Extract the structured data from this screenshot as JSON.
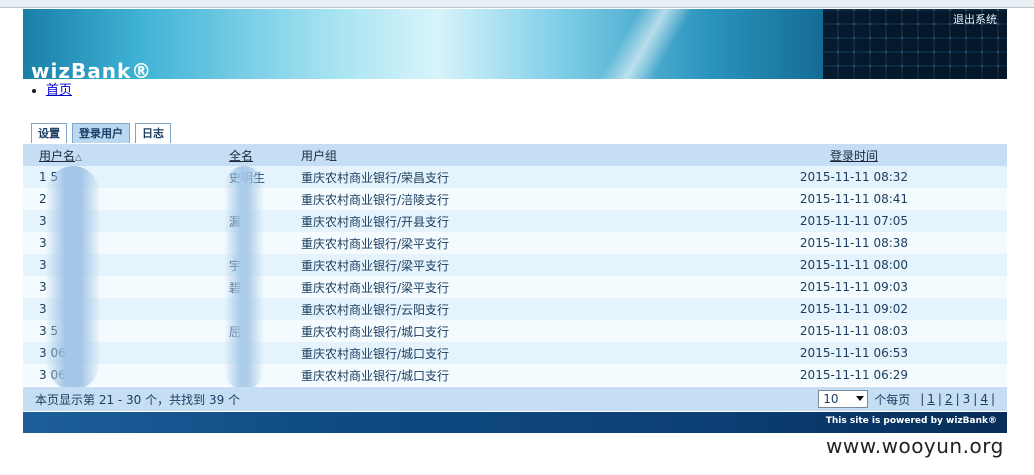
{
  "banner": {
    "logo_text": "wizBank®",
    "top_link": "退出系统"
  },
  "breadcrumb": {
    "home": "首页"
  },
  "tabs": [
    {
      "label": "设置"
    },
    {
      "label": "登录用户"
    },
    {
      "label": "日志"
    }
  ],
  "table": {
    "headers": {
      "user": "用户名",
      "fullname": "全名",
      "group": "用户组",
      "time": "登录时间"
    },
    "rows": [
      {
        "user": "1        5",
        "fullname": "史明生",
        "group": "重庆农村商业银行/荣昌支行",
        "time": "2015-11-11 08:32"
      },
      {
        "user": "2",
        "fullname": "",
        "group": "重庆农村商业银行/涪陵支行",
        "time": "2015-11-11 08:41"
      },
      {
        "user": "3",
        "fullname": "     漏",
        "group": "重庆农村商业银行/开县支行",
        "time": "2015-11-11 07:05"
      },
      {
        "user": "3",
        "fullname": "",
        "group": "重庆农村商业银行/梁平支行",
        "time": "2015-11-11 08:38"
      },
      {
        "user": "3",
        "fullname": "     宇",
        "group": "重庆农村商业银行/梁平支行",
        "time": "2015-11-11 08:00"
      },
      {
        "user": "3",
        "fullname": "     碧",
        "group": "重庆农村商业银行/梁平支行",
        "time": "2015-11-11 09:03"
      },
      {
        "user": "3",
        "fullname": "",
        "group": "重庆农村商业银行/云阳支行",
        "time": "2015-11-11 09:02"
      },
      {
        "user": "3        5",
        "fullname": "屈",
        "group": "重庆农村商业银行/城口支行",
        "time": "2015-11-11 08:03"
      },
      {
        "user": "3       06",
        "fullname": "",
        "group": "重庆农村商业银行/城口支行",
        "time": "2015-11-11 06:53"
      },
      {
        "user": "3       06",
        "fullname": "",
        "group": "重庆农村商业银行/城口支行",
        "time": "2015-11-11 06:29"
      }
    ]
  },
  "footer": {
    "count_text": "本页显示第 21 - 30 个，共找到 39 个",
    "page_size": "10",
    "per_page_label": "个每页",
    "pages": [
      "1",
      "2",
      "3",
      "4"
    ],
    "current_page": "3"
  },
  "powered_by": "This site is powered by wizBank®",
  "watermark": "www.wooyun.org"
}
